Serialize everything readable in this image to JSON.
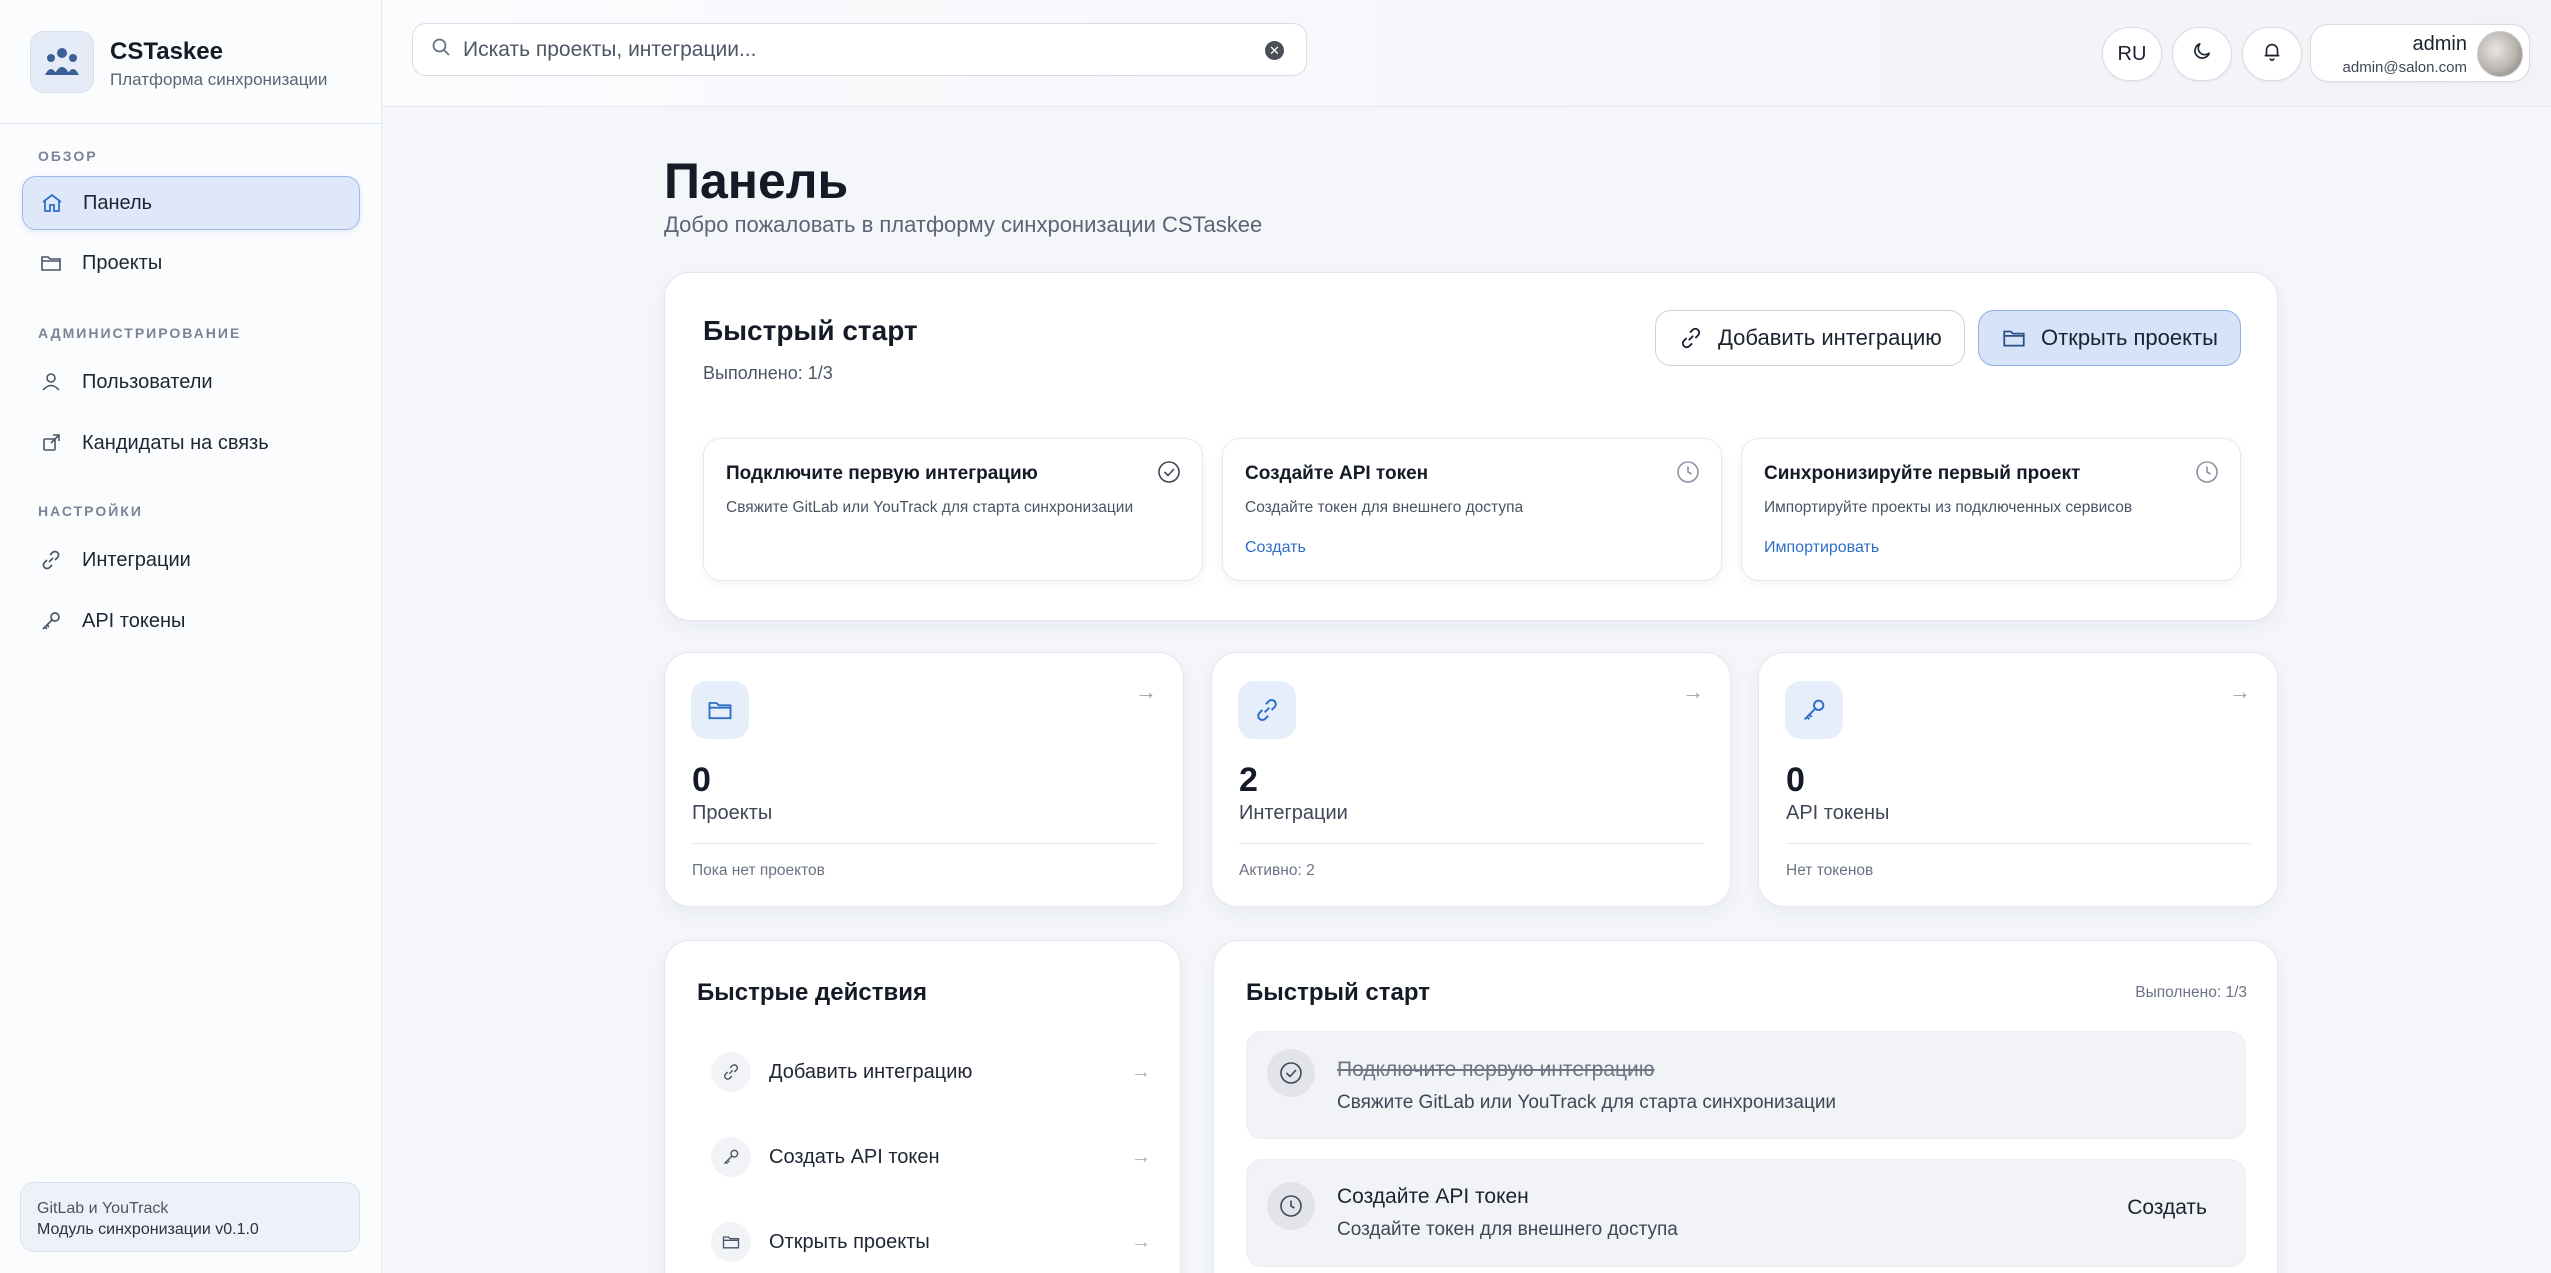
{
  "brand": {
    "name": "CSTaskee",
    "subtitle": "Платформа синхронизации"
  },
  "sidebar": {
    "sections": [
      {
        "label": "ОБЗОР"
      },
      {
        "label": "АДМИНИСТРИРОВАНИЕ"
      },
      {
        "label": "НАСТРОЙКИ"
      }
    ],
    "items": [
      {
        "label": "Панель",
        "icon": "home-icon",
        "active": true
      },
      {
        "label": "Проекты",
        "icon": "folder-icon"
      },
      {
        "label": "Пользователи",
        "icon": "user-icon"
      },
      {
        "label": "Кандидаты на связь",
        "icon": "link-out-icon"
      },
      {
        "label": "Интеграции",
        "icon": "link-icon"
      },
      {
        "label": "API токены",
        "icon": "key-icon"
      }
    ],
    "footer": {
      "line1": "GitLab и YouTrack",
      "line2": "Модуль синхронизации v0.1.0"
    }
  },
  "topbar": {
    "search_placeholder": "Искать проекты, интеграции...",
    "lang": "RU",
    "user": {
      "name": "admin",
      "email": "admin@salon.com"
    }
  },
  "page": {
    "title": "Панель",
    "subtitle": "Добро пожаловать в платформу синхронизации CSTaskee"
  },
  "quick_start": {
    "title": "Быстрый старт",
    "progress": "Выполнено: 1/3",
    "add_integration": "Добавить интеграцию",
    "open_projects": "Открыть проекты",
    "steps": [
      {
        "title": "Подключите первую интеграцию",
        "desc": "Свяжите GitLab или YouTrack для старта синхронизации",
        "link": "",
        "status": "done"
      },
      {
        "title": "Создайте API токен",
        "desc": "Создайте токен для внешнего доступа",
        "link": "Создать",
        "status": "pending"
      },
      {
        "title": "Синхронизируйте первый проект",
        "desc": "Импортируйте проекты из подключенных сервисов",
        "link": "Импортировать",
        "status": "pending"
      }
    ]
  },
  "stats": [
    {
      "value": "0",
      "label": "Проекты",
      "footer": "Пока нет проектов",
      "icon": "folder-icon"
    },
    {
      "value": "2",
      "label": "Интеграции",
      "footer": "Активно: 2",
      "icon": "link-icon"
    },
    {
      "value": "0",
      "label": "API токены",
      "footer": "Нет токенов",
      "icon": "key-icon"
    }
  ],
  "quick_actions": {
    "title": "Быстрые действия",
    "items": [
      {
        "label": "Добавить интеграцию",
        "icon": "link-icon"
      },
      {
        "label": "Создать API токен",
        "icon": "key-icon"
      },
      {
        "label": "Открыть проекты",
        "icon": "folder-icon"
      }
    ]
  },
  "quick_start_list": {
    "title": "Быстрый старт",
    "progress": "Выполнено: 1/3",
    "items": [
      {
        "title": "Подключите первую интеграцию",
        "desc": "Свяжите GitLab или YouTrack для старта синхронизации",
        "done": true,
        "action": ""
      },
      {
        "title": "Создайте API токен",
        "desc": "Создайте токен для внешнего доступа",
        "done": false,
        "action": "Создать"
      }
    ]
  },
  "colors": {
    "accent": "#2e6fc7",
    "active_bg": "#dfe8f8",
    "primary_btn": "#d6e3f8"
  }
}
